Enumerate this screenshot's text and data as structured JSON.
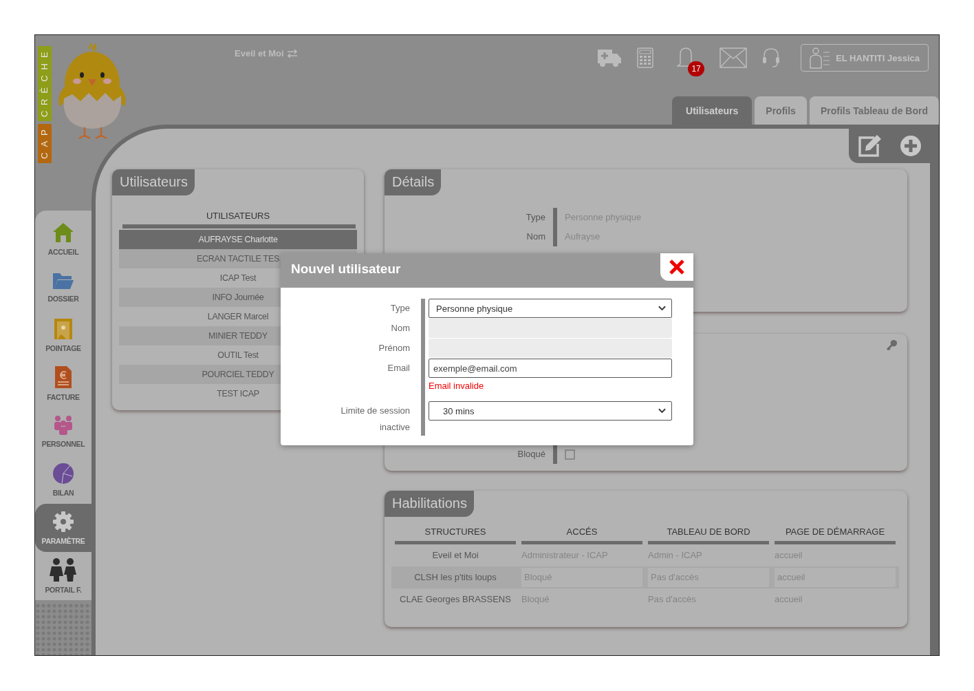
{
  "logo": {
    "words": [
      {
        "text": "CAP",
        "color": "#b3680f"
      },
      {
        "text": "CRÈCHE",
        "color": "#8e9e18"
      }
    ]
  },
  "header": {
    "structure": "Eveil et Moi",
    "notifications": "17",
    "user": "EL HANTITI Jessica"
  },
  "tabs": [
    {
      "label": "Utilisateurs",
      "selected": true
    },
    {
      "label": "Profils",
      "selected": false
    },
    {
      "label": "Profils Tableau de Bord",
      "selected": false
    }
  ],
  "sidebar": {
    "items": [
      {
        "label": "ACCUEIL",
        "kind": "home",
        "selected": false
      },
      {
        "label": "DOSSIER",
        "kind": "folder",
        "selected": false
      },
      {
        "label": "POINTAGE",
        "kind": "clock-in",
        "selected": false
      },
      {
        "label": "FACTURE",
        "kind": "invoice",
        "selected": false
      },
      {
        "label": "PERSONNEL",
        "kind": "staff",
        "selected": false
      },
      {
        "label": "BILAN",
        "kind": "report",
        "selected": false
      },
      {
        "label": "PARAMÈTRE",
        "kind": "settings",
        "selected": true
      },
      {
        "label": "PORTAIL F.",
        "kind": "family",
        "selected": false
      }
    ]
  },
  "users_panel": {
    "title": "Utilisateurs",
    "column": "UTILISATEURS",
    "rows": [
      {
        "name": "AUFRAYSE Charlotte",
        "selected": true
      },
      {
        "name": "ECRAN TACTILE TES",
        "selected": false
      },
      {
        "name": "ICAP Test",
        "selected": false
      },
      {
        "name": "INFO Journée",
        "selected": false
      },
      {
        "name": "LANGER Marcel",
        "selected": false
      },
      {
        "name": "MINIER TEDDY",
        "selected": false
      },
      {
        "name": "OUTIL Test",
        "selected": false
      },
      {
        "name": "POURCIEL TEDDY",
        "selected": false
      },
      {
        "name": "TEST ICAP",
        "selected": false
      }
    ]
  },
  "details_panel": {
    "title": "Détails",
    "fields": [
      {
        "label": "Type",
        "value": "Personne physique"
      },
      {
        "label": "Nom",
        "value": "Aufrayse"
      }
    ]
  },
  "account_panel": {
    "blocked": {
      "label": "Bloqué",
      "checked": false
    }
  },
  "habilitations": {
    "title": "Habilitations",
    "columns": [
      "STRUCTURES",
      "ACCÉS",
      "TABLEAU DE BORD",
      "PAGE DE DÉMARRAGE"
    ],
    "rows": [
      {
        "cells": [
          "Eveil et Moi",
          "Administrateur - ICAP",
          "Admin - ICAP",
          "accueil"
        ],
        "selected": false
      },
      {
        "cells": [
          "CLSH les p'tits loups",
          "Bloqué",
          "Pas d'accès",
          "accueil"
        ],
        "selected": true
      },
      {
        "cells": [
          "CLAE Georges BRASSENS",
          "Bloqué",
          "Pas d'accès",
          "accueil"
        ],
        "selected": false
      }
    ]
  },
  "modal": {
    "title": "Nouvel utilisateur",
    "fields": [
      {
        "label": "Type",
        "kind": "select",
        "value": "Personne physique"
      },
      {
        "label": "Nom",
        "kind": "text",
        "disabled": true
      },
      {
        "label": "Prénom",
        "kind": "text",
        "disabled": true
      },
      {
        "label": "Email",
        "kind": "text",
        "value": "exemple@email.com",
        "disabled": false,
        "error": "Email invalide"
      },
      {
        "label": "Limite de session inactive",
        "kind": "select",
        "value": "30 mins"
      }
    ]
  }
}
